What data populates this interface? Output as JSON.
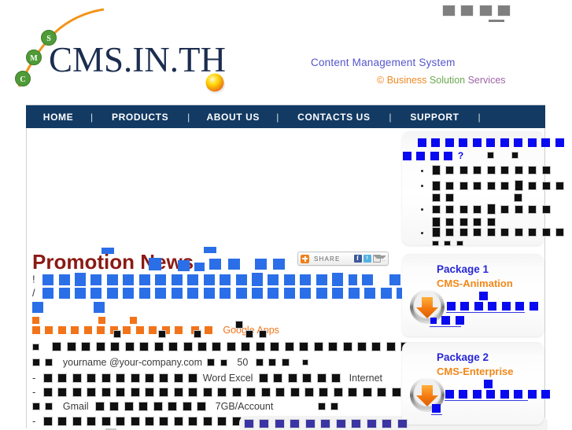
{
  "site": {
    "logo_text": "CMS.IN.TH",
    "logo_nodes": [
      "C",
      "M",
      "S"
    ],
    "tagline": "Content Management System",
    "copyright_mark": "©",
    "business": "Business",
    "solution": "Solution",
    "services": "Services",
    "colors": {
      "nav_bg": "#123a63",
      "brand_navy": "#1b2d4f",
      "accent_orange": "#f2741a",
      "link_blue": "#2727d8",
      "title_red": "#8b1a14",
      "green": "#6aa84f",
      "purple": "#a064a8"
    }
  },
  "topbar": {
    "redacted_block_count": 4
  },
  "nav": {
    "items": [
      {
        "label": "HOME"
      },
      {
        "label": "PRODUCTS"
      },
      {
        "label": "ABOUT US"
      },
      {
        "label": "CONTACTS US"
      },
      {
        "label": "SUPPORT"
      }
    ],
    "separator": "|"
  },
  "main": {
    "promo_title": "Promotion News",
    "bullet_markers": [
      "!",
      "/",
      "-",
      "-"
    ],
    "inline_texts": {
      "google_apps": "Google Apps",
      "email_example": "yourname @your-company.com",
      "quantity": "50",
      "office_apps": "Word  Excel",
      "internet": "Internet",
      "gmail": "Gmail",
      "storage": "7GB/Account"
    }
  },
  "share": {
    "label": "SHARE",
    "plus_icon": "addthis-plus-icon",
    "icons": [
      "facebook-icon",
      "twitter-icon",
      "email-icon"
    ],
    "more": "..",
    "facebook_glyph": "f",
    "twitter_glyph": "t"
  },
  "sidebar": {
    "faq": {
      "question_mark": "?",
      "bullet_count": 4
    },
    "packages": [
      {
        "title": "Package 1",
        "subtitle": "CMS-Animation",
        "icon": "download-icon"
      },
      {
        "title": "Package 2",
        "subtitle": "CMS-Enterprise",
        "icon": "download-icon"
      }
    ]
  }
}
